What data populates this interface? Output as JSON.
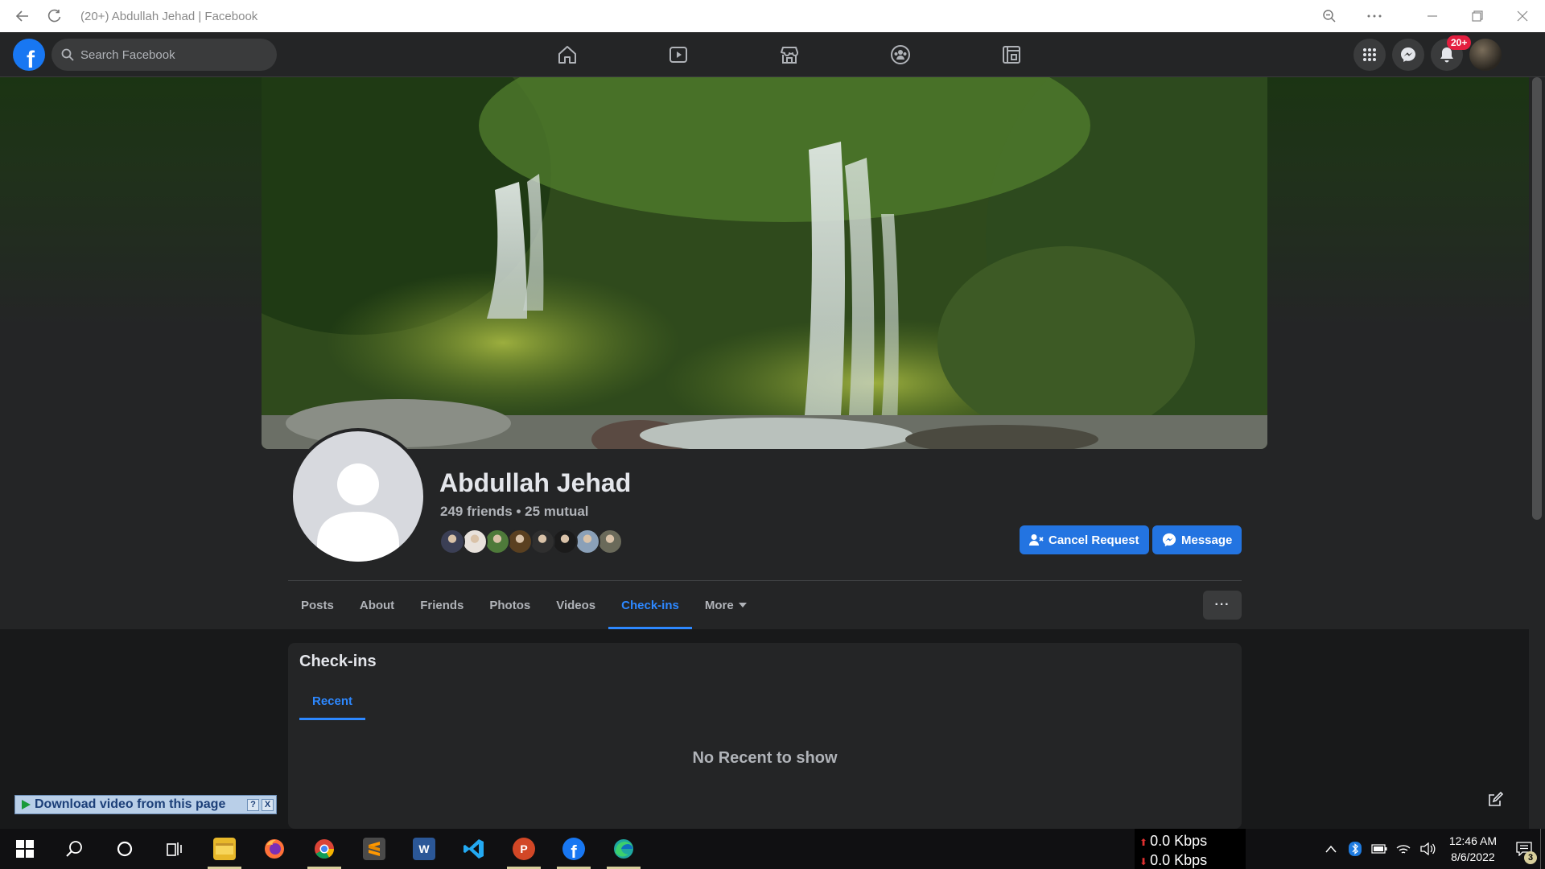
{
  "browser": {
    "title": "(20+) Abdullah Jehad | Facebook",
    "buttons": [
      "back-icon",
      "refresh-icon",
      "zoom-icon",
      "more-icon",
      "minimize-icon",
      "restore-icon",
      "close-icon"
    ]
  },
  "nav": {
    "logo": "f",
    "search_placeholder": "Search Facebook",
    "tabs": [
      "home-icon",
      "watch-icon",
      "marketplace-icon",
      "groups-icon",
      "gaming-icon"
    ],
    "right_icons": [
      "menu-grid-icon",
      "messenger-icon",
      "bell-icon",
      "account-avatar"
    ],
    "notification_badge": "20+"
  },
  "profile": {
    "name": "Abdullah Jehad",
    "friends_text": "249 friends • 25 mutual",
    "friend_avatar_colors": [
      "#3b3f55",
      "#e8e2dc",
      "#4e7a3a",
      "#5a4020",
      "#2f2f2f",
      "#1b1b1b",
      "#8aa0b8",
      "#6a6a5a"
    ],
    "cancel_request_label": "Cancel Request",
    "message_label": "Message",
    "tabs": [
      "Posts",
      "About",
      "Friends",
      "Photos",
      "Videos",
      "Check-ins",
      "More"
    ],
    "active_tab": "Check-ins",
    "more_button": "···"
  },
  "checkins": {
    "title": "Check-ins",
    "subtab": "Recent",
    "empty_message": "No Recent to show"
  },
  "extension": {
    "download_label": "Download video from this page",
    "help": "?",
    "close": "X"
  },
  "taskbar": {
    "apps": [
      "windows-start-icon",
      "search-icon",
      "cortana-icon",
      "task-view-icon",
      "file-explorer-icon",
      "firefox-icon",
      "chrome-icon",
      "sublime-text-icon",
      "word-icon",
      "vscode-icon",
      "powerpoint-icon",
      "facebook-icon",
      "edge-icon"
    ],
    "net_up": "0.0 Kbps",
    "net_down": "0.0 Kbps",
    "time": "12:46 AM",
    "date": "8/6/2022",
    "notification_count": "3"
  },
  "colors": {
    "accent": "#2374e1",
    "link_blue": "#2d88ff",
    "surface": "#242526",
    "background": "#18191a",
    "badge_red": "#e41e3f"
  }
}
